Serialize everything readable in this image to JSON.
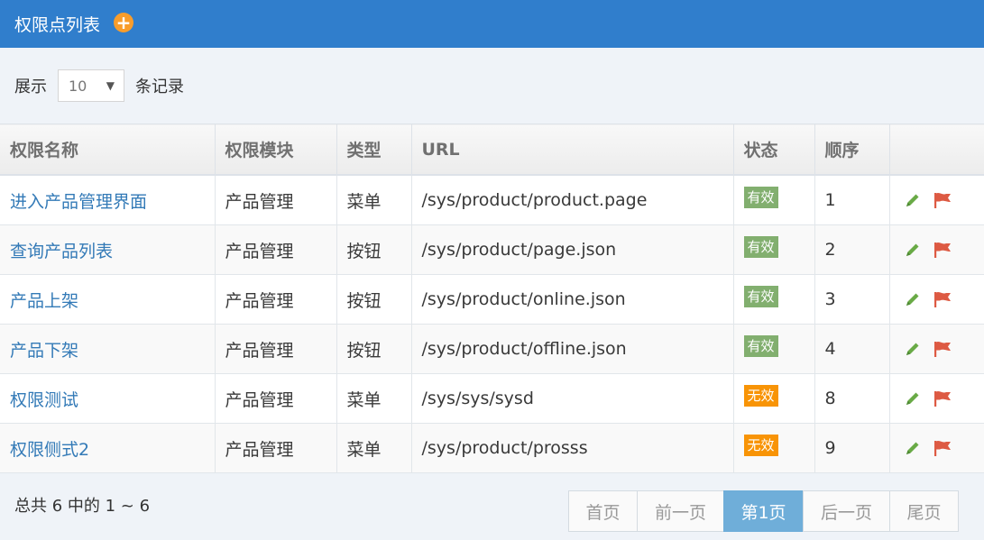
{
  "header": {
    "title": "权限点列表",
    "add_icon": "+"
  },
  "toolbar": {
    "show_label": "展示",
    "page_size": "10",
    "records_label": "条记录"
  },
  "table": {
    "columns": [
      "权限名称",
      "权限模块",
      "类型",
      "URL",
      "状态",
      "顺序",
      ""
    ],
    "rows": [
      {
        "name": "进入产品管理界面",
        "module": "产品管理",
        "type": "菜单",
        "url": "/sys/product/product.page",
        "status": "有效",
        "order": "1"
      },
      {
        "name": "查询产品列表",
        "module": "产品管理",
        "type": "按钮",
        "url": "/sys/product/page.json",
        "status": "有效",
        "order": "2"
      },
      {
        "name": "产品上架",
        "module": "产品管理",
        "type": "按钮",
        "url": "/sys/product/online.json",
        "status": "有效",
        "order": "3"
      },
      {
        "name": "产品下架",
        "module": "产品管理",
        "type": "按钮",
        "url": "/sys/product/offline.json",
        "status": "有效",
        "order": "4"
      },
      {
        "name": "权限测试",
        "module": "产品管理",
        "type": "菜单",
        "url": "/sys/sys/sysd",
        "status": "无效",
        "order": "8"
      },
      {
        "name": "权限侧式2",
        "module": "产品管理",
        "type": "菜单",
        "url": "/sys/product/prosss",
        "status": "无效",
        "order": "9"
      }
    ]
  },
  "footer": {
    "summary": "总共 6 中的 1 ~ 6",
    "pager": {
      "first": "首页",
      "prev": "前一页",
      "current": "第1页",
      "next": "后一页",
      "last": "尾页"
    }
  },
  "colors": {
    "header_bg": "#307ecc",
    "add_icon": "#f89d2c",
    "valid_badge": "#82af6f",
    "invalid_badge": "#f89406",
    "edit_icon": "#69aa46",
    "flag_icon": "#dd5a43",
    "active_page": "#6faed9"
  },
  "icons": {
    "edit": "pencil-icon",
    "flag": "flag-icon",
    "add": "plus-circle-icon"
  }
}
